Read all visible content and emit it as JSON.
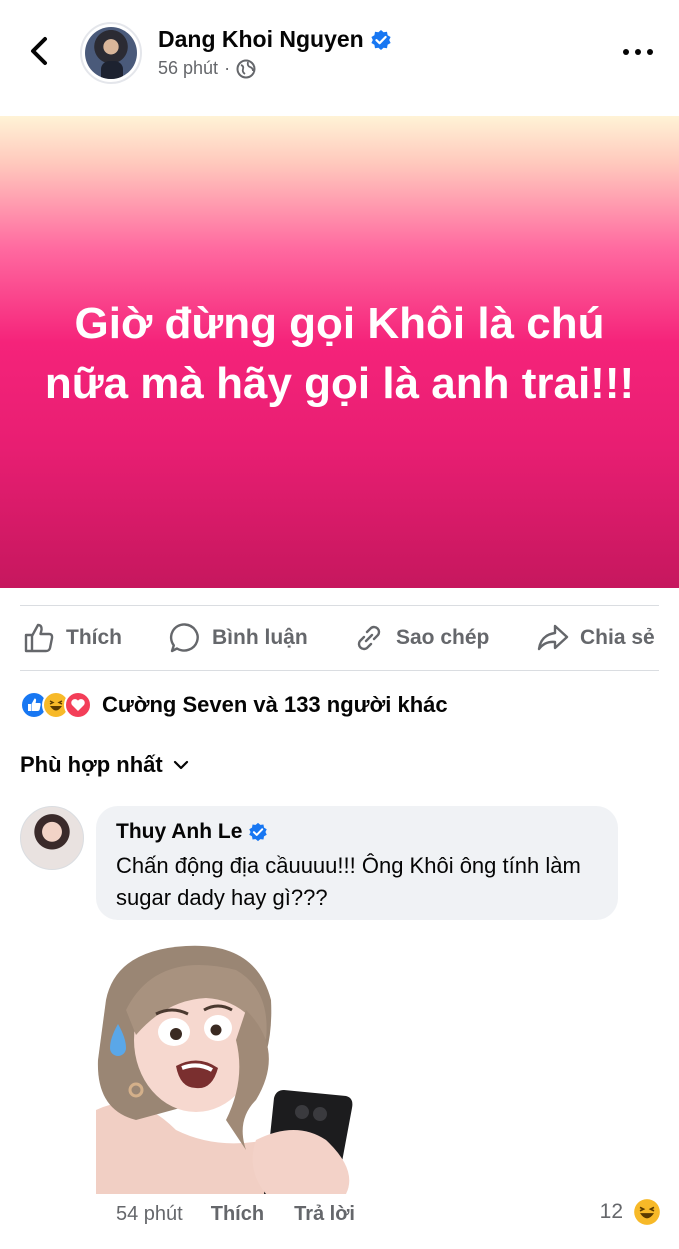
{
  "post": {
    "author": "Dang Khoi Nguyen",
    "time": "56 phút",
    "separator": "·",
    "privacy_icon": "globe-icon",
    "banner_text": "Giờ đừng gọi Khôi là chú nữa mà hãy gọi là anh trai!!!"
  },
  "actions": {
    "like": "Thích",
    "comment": "Bình luận",
    "copy": "Sao chép",
    "share": "Chia sẻ"
  },
  "reactions": {
    "icons": [
      "like-icon",
      "haha-icon",
      "love-icon"
    ],
    "summary": "Cường Seven và 133 người khác"
  },
  "sort": {
    "label": "Phù hợp nhất"
  },
  "comment": {
    "author": "Thuy Anh Le",
    "text": "Chấn động địa cầuuuu!!! Ông Khôi ông tính làm sugar dady hay gì???",
    "time": "54 phút",
    "like": "Thích",
    "reply": "Trả lời",
    "reaction_count": "12"
  },
  "colors": {
    "brand_blue": "#1877f2",
    "banner_pink": "#e81e72",
    "secondary_text": "#65676b"
  }
}
